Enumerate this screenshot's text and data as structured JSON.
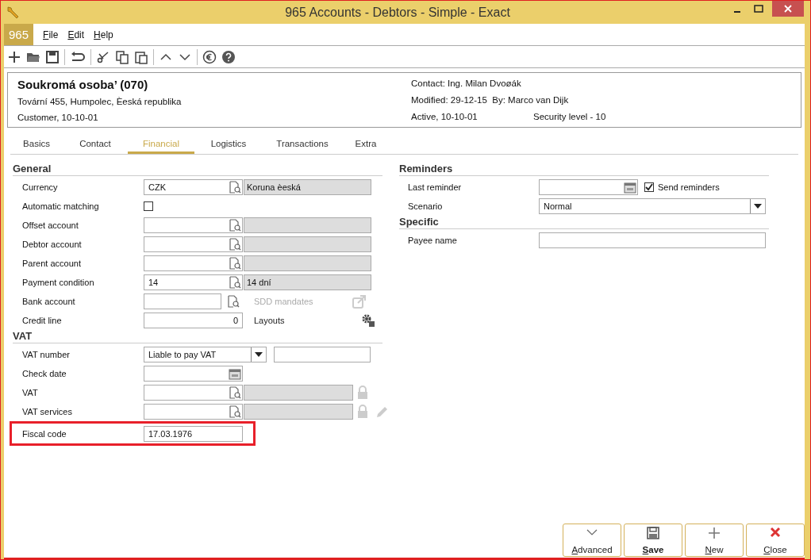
{
  "window": {
    "title": "965 Accounts - Debtors - Simple - Exact"
  },
  "menu": {
    "badge": "965",
    "items": [
      "File",
      "Edit",
      "Help"
    ]
  },
  "header": {
    "name": "Soukromá osoba’ (070)",
    "address": "Tovární 455, Humpolec, Èeská republika",
    "type": "Customer, 10-10-01",
    "contact": "Contact: Ing. Milan Dvoøák",
    "modified": "Modified: 29-12-15  By: Marco van Dijk",
    "status": "Active, 10-10-01",
    "security": "Security level - 10"
  },
  "tabs": [
    {
      "label": "Basics",
      "selected": false
    },
    {
      "label": "Contact",
      "selected": false
    },
    {
      "label": "Financial",
      "selected": true
    },
    {
      "label": "Logistics",
      "selected": false
    },
    {
      "label": "Transactions",
      "selected": false
    },
    {
      "label": "Extra",
      "selected": false
    }
  ],
  "general": {
    "title": "General",
    "rows": [
      {
        "kind": "lookup",
        "label": "Currency",
        "value": "CZK",
        "description": "Koruna èeská"
      },
      {
        "kind": "checkbox",
        "label": "Automatic matching",
        "checked": false
      },
      {
        "kind": "lookup",
        "label": "Offset account"
      },
      {
        "kind": "lookup",
        "label": "Debtor account"
      },
      {
        "kind": "lookup",
        "label": "Parent account"
      },
      {
        "kind": "lookup",
        "label": "Payment condition",
        "value": "14",
        "description": "14 dní"
      },
      {
        "kind": "bank",
        "label": "Bank account",
        "link": "SDD mandates",
        "link_disabled": true
      },
      {
        "kind": "number",
        "label": "Credit line",
        "value": "0",
        "link": "Layouts"
      }
    ]
  },
  "vat": {
    "title": "VAT",
    "rows": [
      {
        "kind": "select",
        "label": "VAT number",
        "value": "Liable to pay VAT"
      },
      {
        "kind": "date",
        "label": "Check date"
      },
      {
        "kind": "locked",
        "label": "VAT",
        "editable": false
      },
      {
        "kind": "locked",
        "label": "VAT services",
        "editable": true
      },
      {
        "kind": "text",
        "label": "Fiscal code",
        "value": "17.03.1976",
        "highlighted": true
      }
    ]
  },
  "reminders": {
    "title": "Reminders",
    "last_reminder_label": "Last reminder",
    "send_label": "Send reminders",
    "send_checked": true,
    "scenario_label": "Scenario",
    "scenario": "Normal"
  },
  "specific": {
    "title": "Specific",
    "payee_label": "Payee name"
  },
  "buttons": [
    {
      "kind": "advanced",
      "label": "Advanced",
      "bold": false
    },
    {
      "kind": "save",
      "label": "Save",
      "bold": true
    },
    {
      "kind": "new",
      "label": "New",
      "bold": false
    },
    {
      "kind": "close",
      "label": "Close",
      "bold": false
    }
  ]
}
